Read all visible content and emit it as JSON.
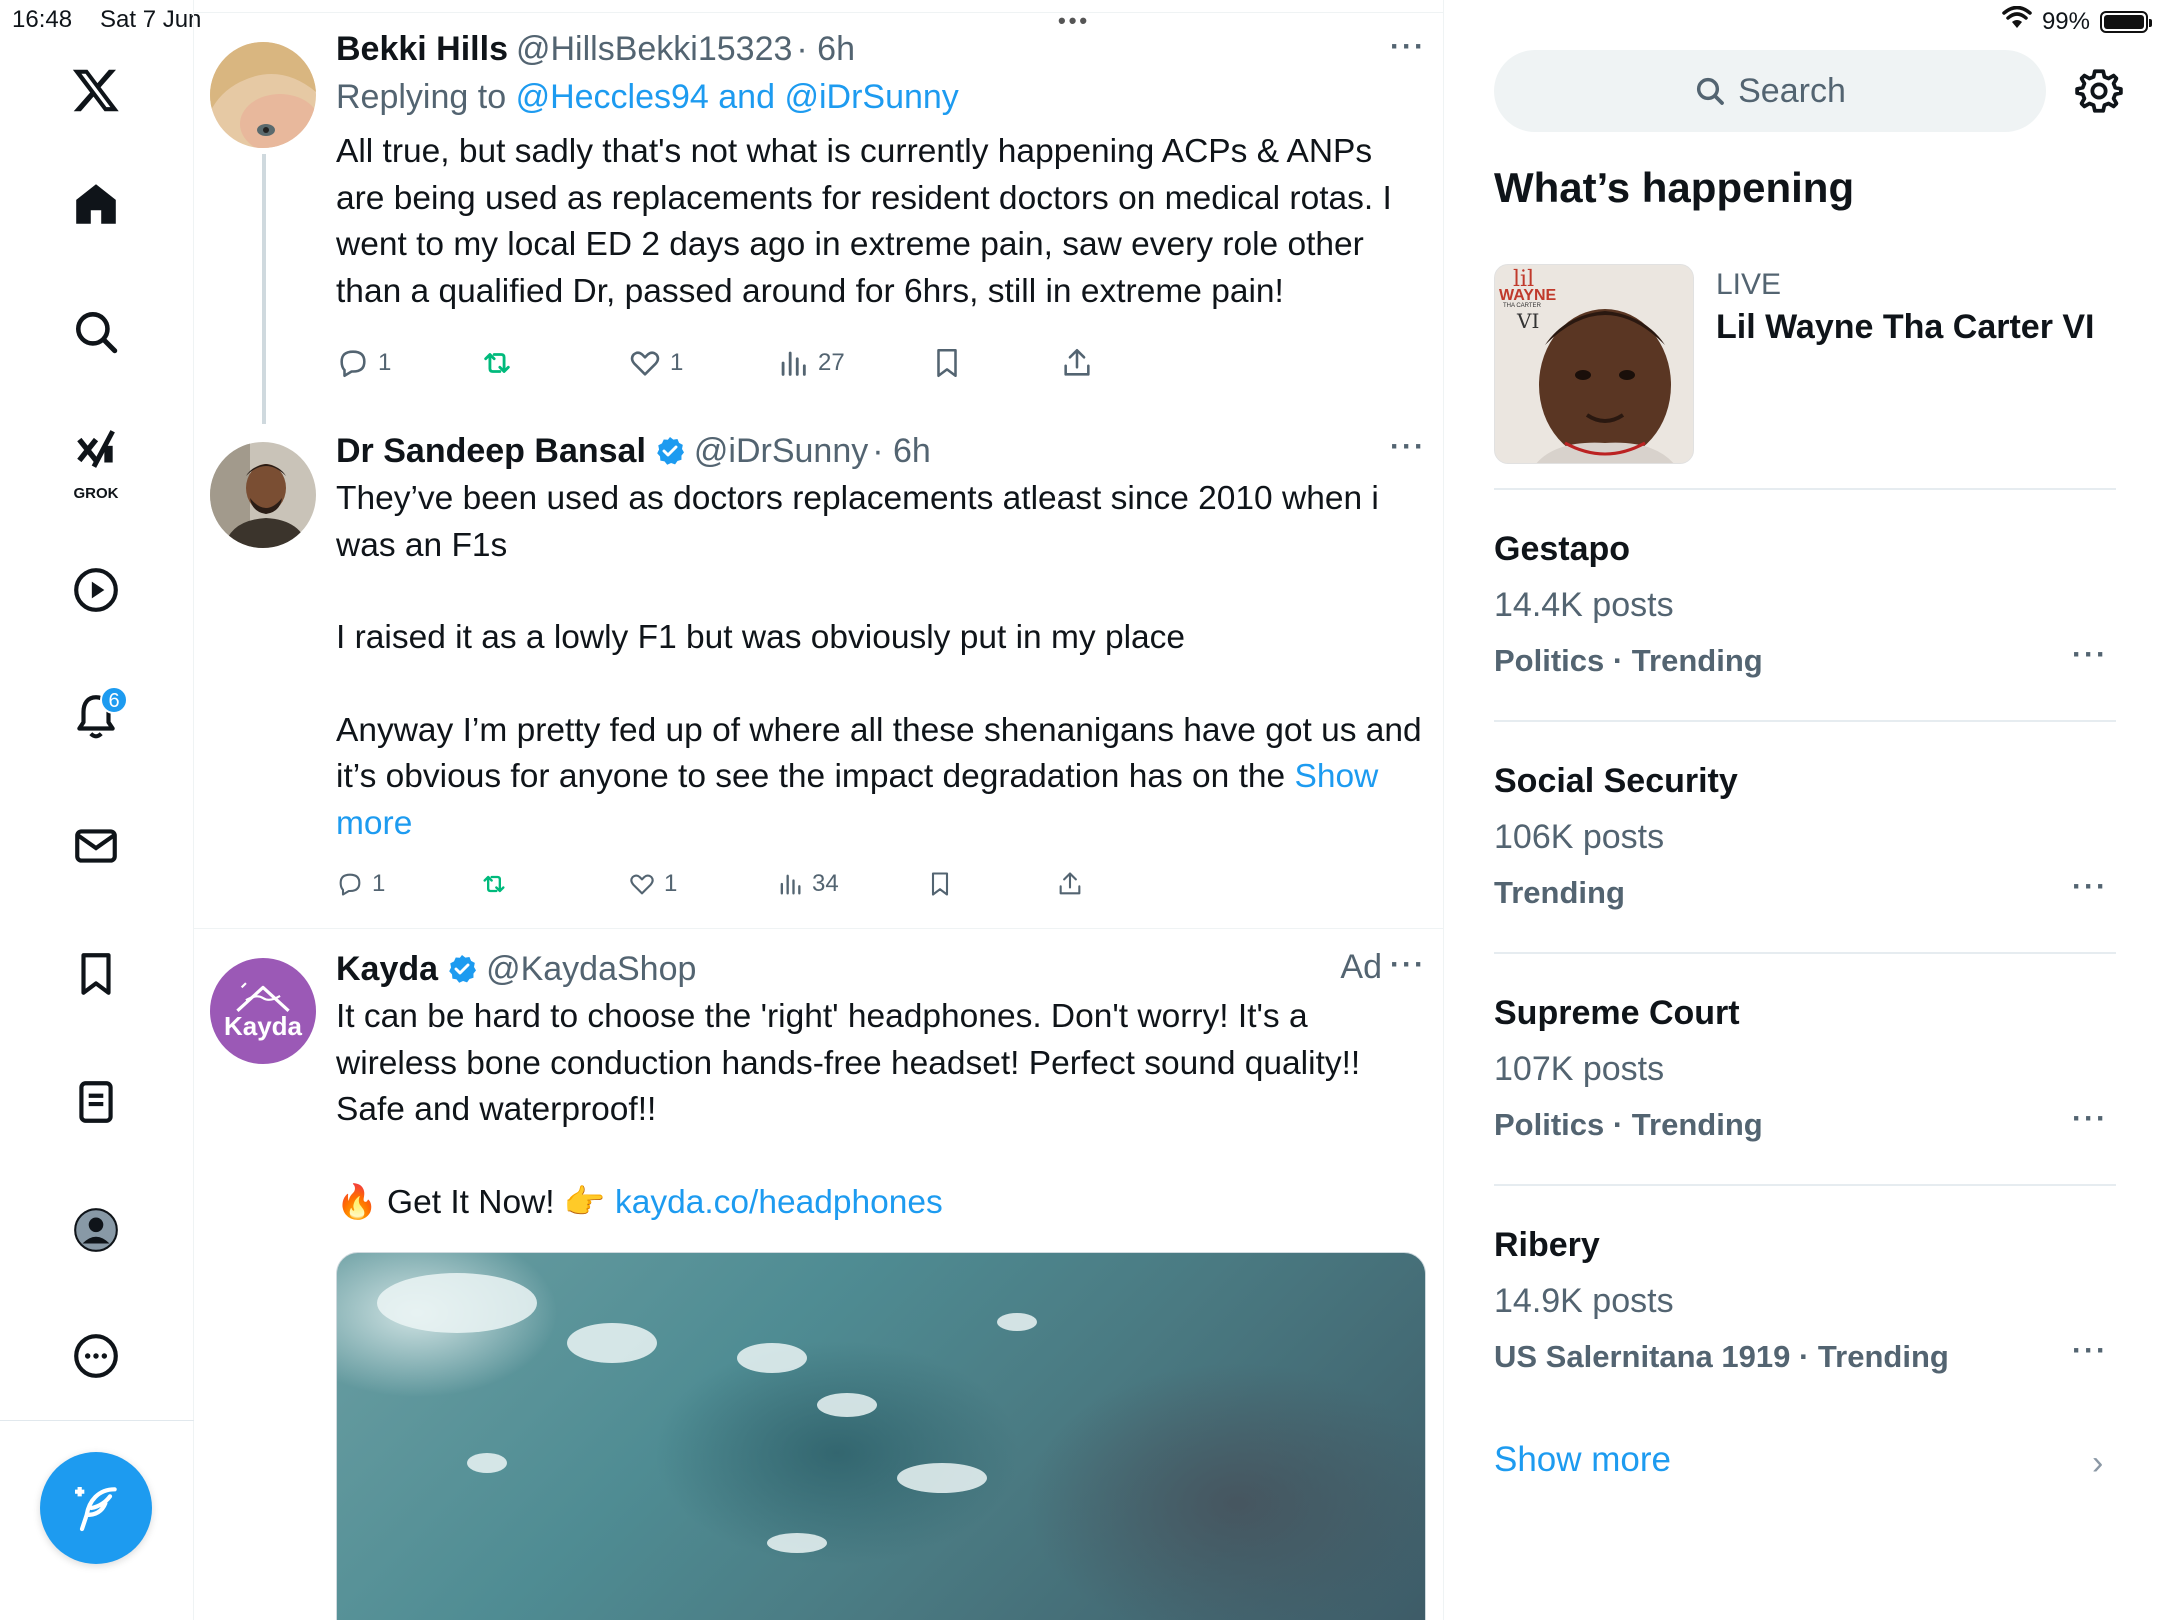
{
  "status_bar": {
    "time": "16:48",
    "date": "Sat 7 Jun",
    "battery": "99%",
    "battery_level": 0.99
  },
  "nav": {
    "notification_count": "6",
    "grok_label": "GROK"
  },
  "tweets": [
    {
      "name": "Bekki Hills",
      "handle": "@HillsBekki15323",
      "time": "· 6h",
      "reply_prefix": "Replying to",
      "reply_to": "@Heccles94 and @iDrSunny",
      "text": "All true, but sadly that's not what is currently happening ACPs & ANPs are being used as replacements for resident doctors on medical rotas. I went to my local ED 2 days ago in extreme pain, saw every role other than a qualified Dr, passed around for 6hrs, still in extreme pain!",
      "replies": "1",
      "likes": "1",
      "views": "27"
    },
    {
      "name": "Dr Sandeep Bansal",
      "handle": "@iDrSunny",
      "time": "· 6h",
      "text_p1": "They’ve been used as doctors replacements atleast since 2010 when i was an F1s",
      "text_p2": "I raised it as a lowly F1 but was obviously put in my place",
      "text_p3": "Anyway I’m pretty fed up of where all these shenanigans have got us and it’s obvious for anyone to see the impact degradation has on the",
      "show_more": "Show more",
      "replies": "1",
      "likes": "1",
      "views": "34"
    },
    {
      "name": "Kayda",
      "handle": "@KaydaShop",
      "ad_label": "Ad",
      "avatar_text": "Kayda",
      "text_p1": "It can be hard to choose the 'right' headphones. Don't worry! It's a wireless bone conduction hands-free headset! Perfect sound quality!! Safe and waterproof!!",
      "cta_emoji_fire": "🔥",
      "cta_text": "Get It Now!",
      "cta_emoji_hand": "👉",
      "cta_link": "kayda.co/headphones"
    }
  ],
  "sidebar": {
    "search_placeholder": "Search",
    "title": "What’s happening",
    "live": {
      "label": "LIVE",
      "title": "Lil Wayne Tha Carter VI",
      "thumb_text_top": "lil",
      "thumb_text_name": "WAYNE",
      "thumb_text_sub": "THA CARTER",
      "thumb_text_num": "VI"
    },
    "trends": [
      {
        "name": "Gestapo",
        "posts": "14.4K posts",
        "category": "Politics · Trending"
      },
      {
        "name": "Social Security",
        "posts": "106K posts",
        "category": "Trending"
      },
      {
        "name": "Supreme Court",
        "posts": "107K posts",
        "category": "Politics · Trending"
      },
      {
        "name": "Ribery",
        "posts": "14.9K posts",
        "category": "US Salernitana 1919 · Trending"
      }
    ],
    "show_more": "Show more"
  },
  "colors": {
    "accent": "#1d9bf0",
    "retweet_green": "#00ba7c",
    "muted": "#536471",
    "kayda_purple": "#9b59b6"
  }
}
